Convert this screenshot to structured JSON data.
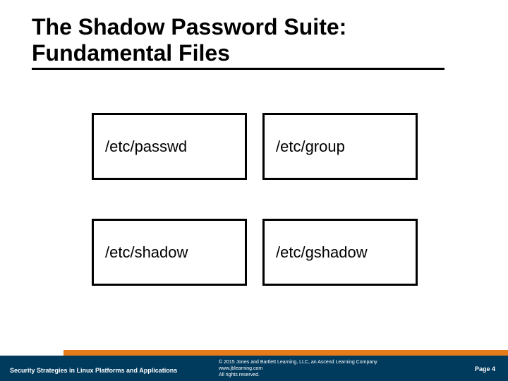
{
  "title_line1": "The Shadow Password Suite:",
  "title_line2": "Fundamental Files",
  "files": {
    "f1": "/etc/passwd",
    "f2": "/etc/group",
    "f3": "/etc/shadow",
    "f4": "/etc/gshadow"
  },
  "footer": {
    "left": "Security Strategies in Linux Platforms and Applications",
    "copyright": "© 2015 Jones and Bartlett Learning, LLC, an Ascend Learning Company",
    "url": "www.jblearning.com",
    "rights": "All rights reserved.",
    "page": "Page 4"
  }
}
